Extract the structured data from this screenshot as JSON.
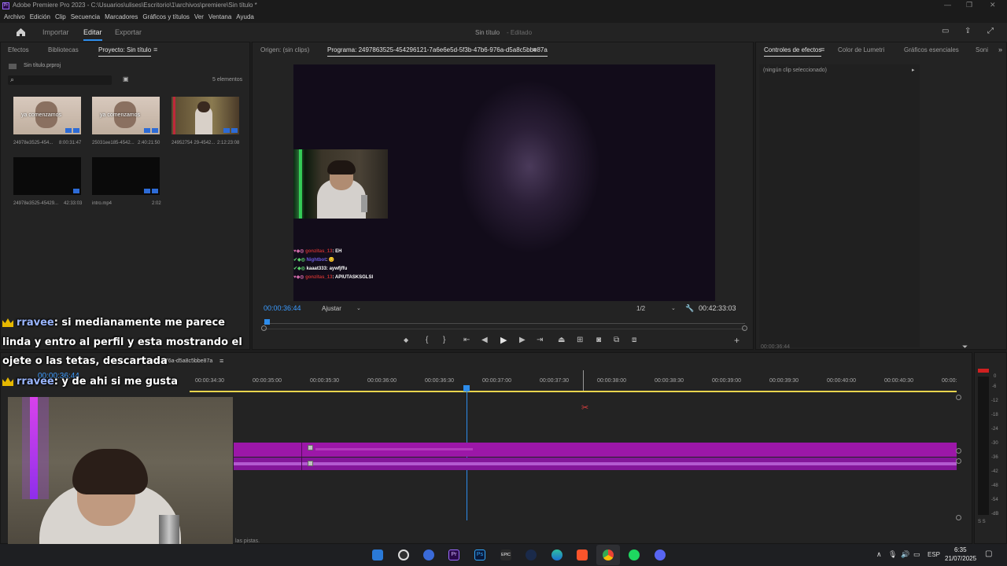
{
  "window": {
    "title": "Adobe Premiere Pro 2023 - C:\\Usuarios\\ulises\\Escritorio\\1\\archivos\\premiere\\Sin título *",
    "logo_text": "Pr"
  },
  "menu": [
    "Archivo",
    "Edición",
    "Clip",
    "Secuencia",
    "Marcadores",
    "Gráficos y títulos",
    "Ver",
    "Ventana",
    "Ayuda"
  ],
  "workspace": {
    "tabs": [
      "Importar",
      "Editar",
      "Exportar"
    ],
    "active": "Editar",
    "project_title": "Sin título",
    "status": "- Editado"
  },
  "project_panel": {
    "tabs": [
      "Efectos",
      "Bibliotecas",
      "Proyecto: Sin título"
    ],
    "file": "Sin título.prproj",
    "count": "5 elementos",
    "items": [
      {
        "name": "24978e3525-454...",
        "duration": "8:00:31:47",
        "overlay": "ya comenzamos"
      },
      {
        "name": "25031ee185-4542...",
        "duration": "2:40:21:50",
        "overlay": "ya comenzamos"
      },
      {
        "name": "24952754 29-4542...",
        "duration": "2:12:23:08",
        "overlay": ""
      },
      {
        "name": "24978e3525-45429...",
        "duration": "42:33:03",
        "overlay": ""
      },
      {
        "name": "intro.mp4",
        "duration": "2:02",
        "overlay": ""
      }
    ]
  },
  "source_tab": "Origen: (sin clips)",
  "program": {
    "tab": "Programa: 2497863525-454296121-7a6e6e5d-5f3b-47b6-976a-d5a8c5bbe87a",
    "timecode": "00:00:36:44",
    "fit": "Ajustar",
    "resolution": "1/2",
    "duration": "00:42:33:03",
    "chat_lines": [
      {
        "user": "gonzitas_13",
        "msg": ": EH",
        "color": "#c03030"
      },
      {
        "user": "Nightbot",
        "msg": ": 😊",
        "color": "#6b5be0"
      },
      {
        "user": "kaaat333",
        "msg": ": aywfjffu",
        "color": "#ffffff"
      },
      {
        "user": "gonzitas_13",
        "msg": ": APIUTASKSGLSI",
        "color": "#c03030"
      }
    ]
  },
  "effect_controls": {
    "tabs": [
      "Controles de efectos",
      "Color de Lumetri",
      "Gráficos esenciales",
      "Soni"
    ],
    "no_clip": "(ningún clip seleccionado)",
    "timecode": "00:00:36:44"
  },
  "timeline": {
    "sequence_suffix": "976a-d5a8c5bbe87a",
    "timecode": "00:00:36:44",
    "ruler": [
      "00:00:34:30",
      "00:00:35:00",
      "00:00:35:30",
      "00:00:36:00",
      "00:00:36:30",
      "00:00:37:00",
      "00:00:37:30",
      "00:00:38:00",
      "00:00:38:30",
      "00:00:39:00",
      "00:00:39:30",
      "00:00:40:00",
      "00:00:40:30",
      "00:00:"
    ],
    "status": "las pistas."
  },
  "overlay_chat": [
    {
      "user": "rravee",
      "text": ": si medianamente me parece"
    },
    {
      "user": "",
      "text": "linda y entro al perfil y esta mostrando el"
    },
    {
      "user": "",
      "text": "ojete o las tetas, descartada"
    },
    {
      "user": "rravee",
      "text": ": y de ahi si me gusta"
    }
  ],
  "meter": [
    "0",
    "-6",
    "-12",
    "-18",
    "-24",
    "-30",
    "-36",
    "-42",
    "-48",
    "-54",
    "-dB"
  ],
  "meter_footer": "S S",
  "taskbar": {
    "lang": "ESP",
    "time": "6:35",
    "date": "21/07/2025",
    "apps": [
      "files-icon",
      "obs-icon",
      "ccleaner-icon",
      "premiere-icon",
      "photoshop-icon",
      "epic-icon",
      "steam-icon",
      "edge-icon",
      "brave-icon",
      "chrome-icon",
      "spotify-icon",
      "discord-icon"
    ]
  }
}
